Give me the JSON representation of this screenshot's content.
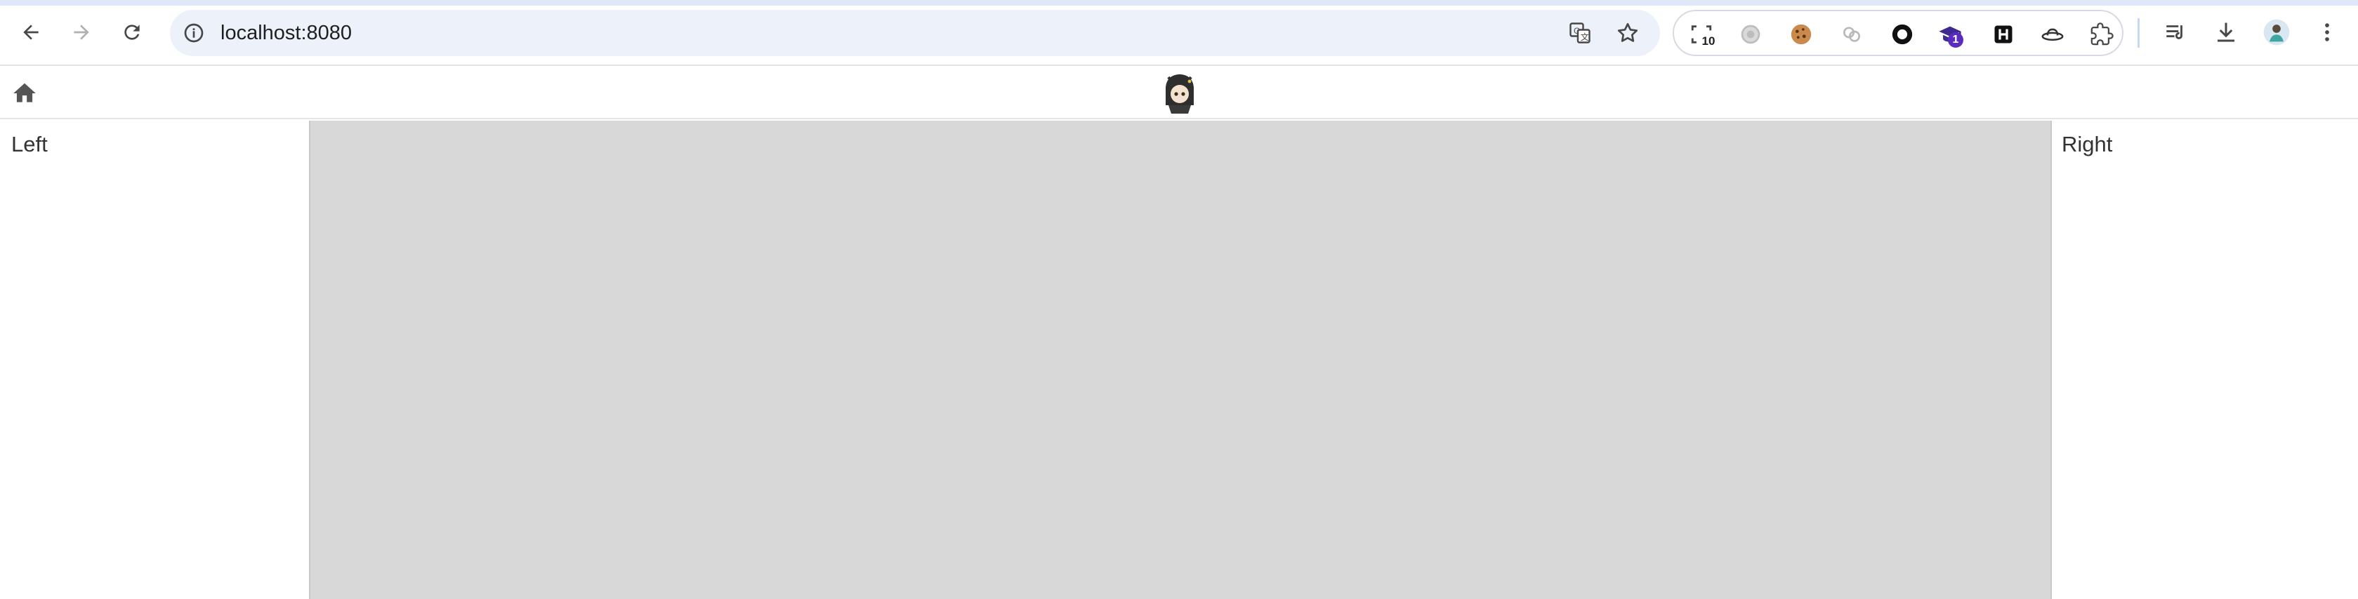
{
  "browser": {
    "url": "localhost:8080",
    "icons": {
      "back": "back-arrow-icon",
      "forward": "forward-arrow-icon",
      "reload": "reload-icon",
      "info": "site-info-icon",
      "translate": "translate-icon",
      "bookmark": "star-icon"
    },
    "extensions": [
      {
        "name": "screenshot-extension-icon",
        "badge": "10"
      },
      {
        "name": "extension-gray-icon",
        "badge": ""
      },
      {
        "name": "cookie-extension-icon",
        "badge": ""
      },
      {
        "name": "chain-extension-icon",
        "badge": ""
      },
      {
        "name": "ring-extension-icon",
        "badge": ""
      },
      {
        "name": "graduation-extension-icon",
        "badge": "1"
      },
      {
        "name": "h-extension-icon",
        "badge": ""
      },
      {
        "name": "hat-extension-icon",
        "badge": ""
      },
      {
        "name": "extensions-puzzle-icon",
        "badge": ""
      }
    ],
    "toolbar_right": [
      "reading-list-icon",
      "download-icon",
      "profile-avatar-icon",
      "menu-kebab-icon"
    ]
  },
  "app": {
    "home_icon": "home-icon",
    "logo_icon": "mascot-logo-icon"
  },
  "panels": {
    "left_label": "Left",
    "right_label": "Right"
  },
  "colors": {
    "center_bg": "#d8d8d8",
    "omnibox_bg": "#edf2fa",
    "badge_dark": "#1f1f1f",
    "badge_purple": "#5b2bbf"
  }
}
